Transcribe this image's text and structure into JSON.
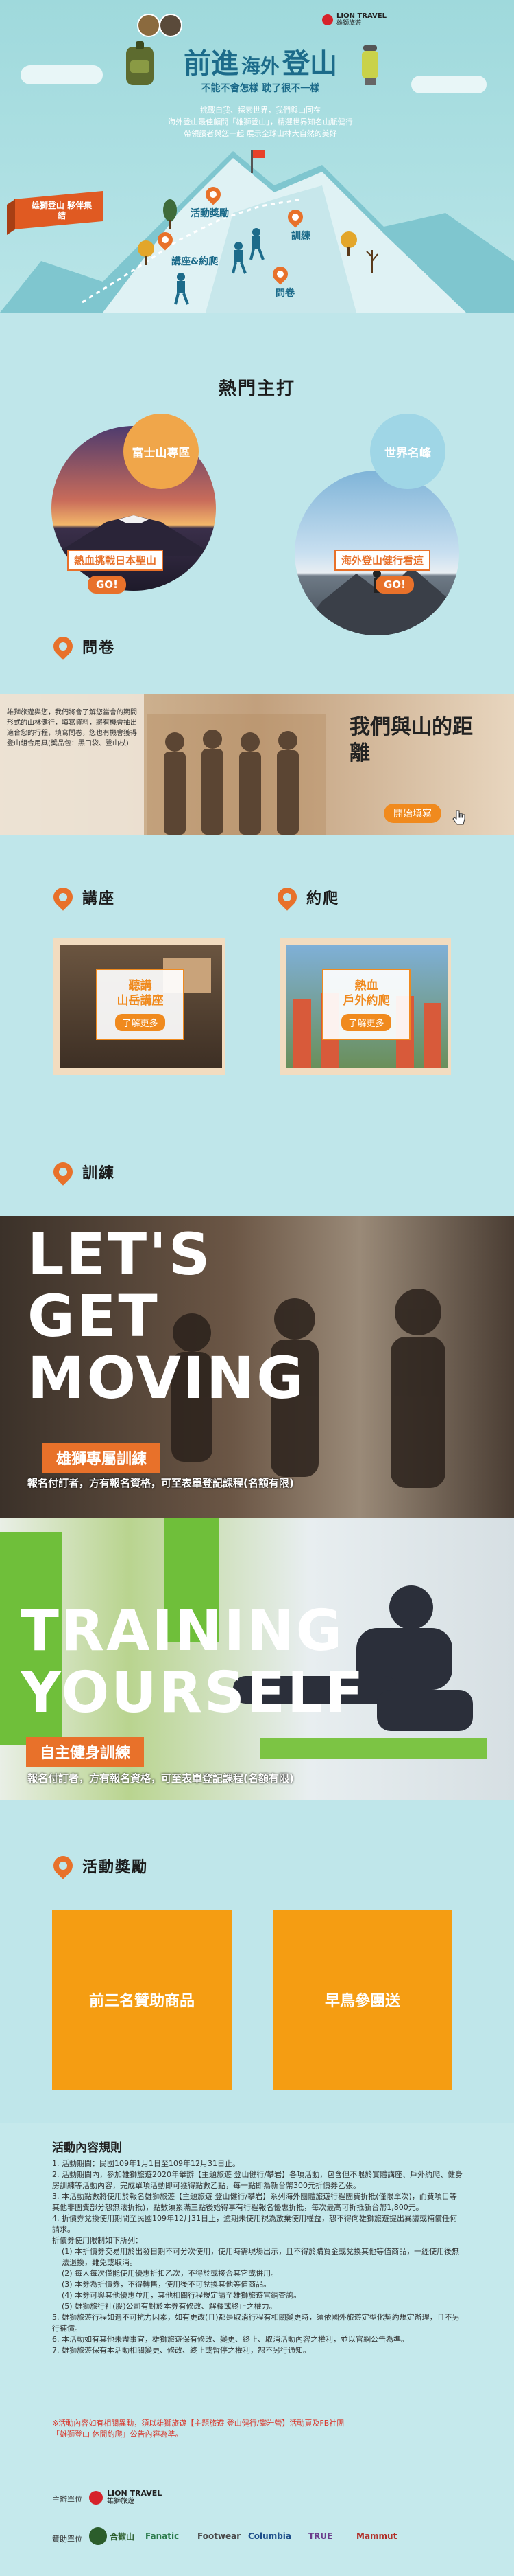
{
  "hero": {
    "brand_en": "LION TRAVEL",
    "brand_cn": "雄獅旅遊",
    "title_a": "前進",
    "title_b": "海外",
    "title_c": "登山",
    "slogan": "不能不會怎樣 耽了很不一樣",
    "intro_lines": [
      "挑戰自我、探索世界，我們與山同在",
      "海外登山最佳顧問「雄獅登山」，精選世界知名山脈健行",
      "帶領讀者與您一起 展示全球山林大自然的美好"
    ],
    "ribbon": "雄獅登山 夥伴集結",
    "labels": {
      "activity": "活動獎勵",
      "training": "訓練",
      "lecture": "講座&約爬",
      "survey": "問卷"
    }
  },
  "hot": {
    "title": "熱門主打",
    "items": [
      {
        "badge": "富士山專區",
        "tag": "熱血挑戰日本聖山",
        "go": "GO!"
      },
      {
        "badge": "世界名峰",
        "tag": "海外登山健行看這",
        "go": "GO!"
      }
    ]
  },
  "survey": {
    "heading": "問卷",
    "text": "雄獅旅遊與您，我們將會了解您當會的期間形式的山林健行，填寫資料，將有機會抽出適合您的行程，填寫問卷，您也有機會獲得登山組合用具(獎品包：黑口袋、登山杖)",
    "banner_title": "我們與山的距離",
    "button": "開始填寫"
  },
  "lecture": {
    "heading": "講座",
    "title_lines": [
      "聽講",
      "山岳講座"
    ],
    "button": "了解更多"
  },
  "climb": {
    "heading": "約爬",
    "title_lines": [
      "熱血",
      "戶外約爬"
    ],
    "button": "了解更多"
  },
  "training": {
    "heading": "訓練",
    "banner1": {
      "lines": [
        "LET'S",
        "GET",
        "MOVING"
      ],
      "label": "雄獅專屬訓練",
      "sub": "報名付訂者，方有報名資格，可至表單登記課程(名額有限)"
    },
    "banner2": {
      "lines": [
        "TRAINING",
        "YOURSELF"
      ],
      "label": "自主健身訓練",
      "sub": "報名付訂者，方有報名資格，可至表單登記課程(名額有限)"
    }
  },
  "reward": {
    "heading": "活動獎勵",
    "box1": "前三名贊助商品",
    "box2": "早鳥參團送"
  },
  "rules": {
    "title": "活動內容規則",
    "items": [
      "1. 活動期間：民國109年1月1日至109年12月31日止。",
      "2. 活動期間內，參加雄獅旅遊2020年舉辦【主題旅遊 登山健行/攀岩】各項活動，包含但不限於實體講座、戶外約爬、健身房訓練等活動內容，完成單項活動即可獲得點數乙點，每一點即為新台幣300元折價券乙張。",
      "3. 本活動點數將使用於報名雄獅旅遊【主題旅遊 登山健行/攀岩】系列海外團體旅遊行程團費折抵(僅限單次)，而費項目等其他非團費部分恕無法折抵)，點數須累滿三點後始得享有行程報名優惠折抵，每次最高可折抵新台幣1,800元。",
      "4. 折價券兌換使用期間至民國109年12月31日止，逾期未使用視為放棄使用權益，恕不得向雄獅旅遊提出異議或補償任何請求。",
      "折價券使用限制如下所列：",
      "(1) 本折價券交易用於出發日期不可分次使用，使用時需現場出示，且不得於購買金或兌換其他等值商品，一經使用後無法退換，難免或取消。",
      "(2) 每人每次僅能使用優惠折扣乙次，不得於或接合其它或併用。",
      "(3) 本券為折價券，不得轉售，使用後不可兌換其他等值商品。",
      "(4) 本券可與其他優惠並用，其他相關行程規定請至雄獅旅遊官網查詢。",
      "(5) 雄獅旅行社(股)公司有對於本券有修改、解釋或終止之權力。",
      "5. 雄獅旅遊行程如遇不可抗力因素，如有更改(且)都是取消行程有相關變更時，須依國外旅遊定型化契約規定辦理，且不另行補償。",
      "6. 本活動如有其他未盡事宜，雄獅旅遊保有修改、變更、終止、取消活動內容之權利，並以官網公告為準。",
      "7. 雄獅旅遊保有本活動相關變更、修改、終止或暫停之權利，恕不另行通知。"
    ],
    "note1": "※活動內容如有相關異動，須以雄獅旅遊【主題旅遊 登山健行/攀岩營】活動頁及FB社團",
    "note2": "「雄獅登山 休閒約爬」公告內容為準。",
    "organizer_label": "主辦單位",
    "sponsor_label": "贊助單位",
    "sponsors": [
      "合歡山",
      "Fanatic",
      "Footwear",
      "Columbia",
      "TRUE",
      "Mammut"
    ]
  }
}
